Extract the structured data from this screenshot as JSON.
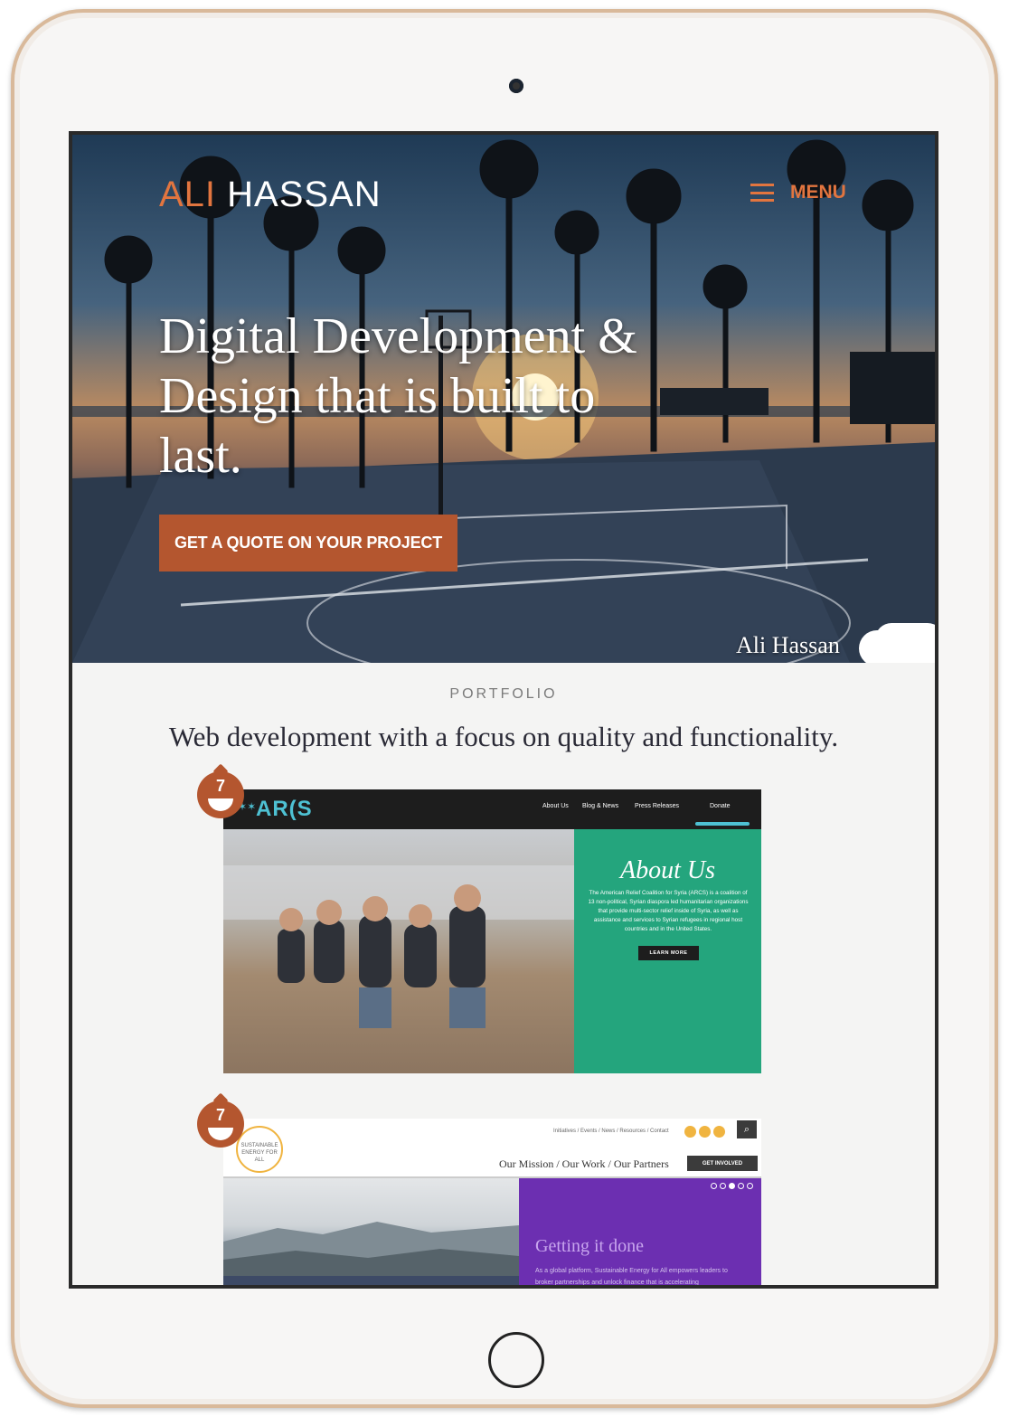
{
  "header": {
    "logo_first": "ALI",
    "logo_last": "HASSAN",
    "menu_label": "MENU"
  },
  "hero": {
    "headline": "Digital Development & Design that is built to last.",
    "cta_label": "GET A QUOTE ON YOUR PROJECT",
    "signature": "Ali Hassan"
  },
  "portfolio": {
    "kicker": "PORTFOLIO",
    "subheading": "Web development with a focus on quality and functionality.",
    "drupal_badge": "7",
    "projects": [
      {
        "logo": "AR(S",
        "nav": [
          "About Us",
          "Blog & News",
          "Press Releases",
          "Donate"
        ],
        "panel_title": "About Us",
        "panel_text": "The American Relief Coalition for Syria (ARCS) is a coalition of 13 non-political, Syrian diaspora led humanitarian organizations that provide multi-sector relief inside of Syria, as well as assistance and services to Syrian refugees in regional host countries and in the United States.",
        "panel_button": "LEARN MORE"
      },
      {
        "logo": "SUSTAINABLE ENERGY FOR ALL",
        "top_links": "Initiatives / Events / News / Resources / Contact",
        "main_nav": "Our Mission / Our Work / Our Partners",
        "nav_button": "GET INVOLVED",
        "panel_title": "Getting it done",
        "panel_text": "As a global platform, Sustainable Energy for All empowers leaders to broker partnerships and unlock finance that is accelerating"
      }
    ]
  },
  "colors": {
    "accent": "#e2753f",
    "cta": "#b4562f",
    "arcs_green": "#24a57d",
    "se_purple": "#6c2fb1"
  }
}
